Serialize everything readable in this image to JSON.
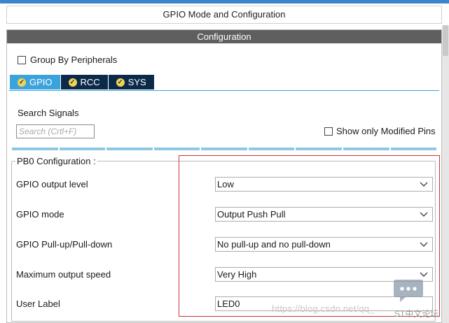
{
  "window": {
    "title": "GPIO Mode and Configuration"
  },
  "panel": {
    "header": "Configuration"
  },
  "group_by": {
    "label": "Group By Peripherals",
    "checked": false
  },
  "tabs": [
    {
      "label": "GPIO",
      "icon": "check-circle-icon",
      "active": true
    },
    {
      "label": "RCC",
      "icon": "check-circle-icon",
      "active": false
    },
    {
      "label": "SYS",
      "icon": "check-circle-icon",
      "active": false
    }
  ],
  "search": {
    "label": "Search Signals",
    "placeholder": "Search (Crtl+F)",
    "value": ""
  },
  "modified_pins": {
    "label": "Show only Modified Pins",
    "checked": false
  },
  "pb0": {
    "legend": "PB0 Configuration :",
    "rows": [
      {
        "label": "GPIO output level",
        "value": "Low",
        "type": "select"
      },
      {
        "label": "GPIO mode",
        "value": "Output Push Pull",
        "type": "select"
      },
      {
        "label": "GPIO Pull-up/Pull-down",
        "value": "No pull-up and no pull-down",
        "type": "select"
      },
      {
        "label": "Maximum output speed",
        "value": "Very High",
        "type": "select"
      },
      {
        "label": "User Label",
        "value": "LED0",
        "type": "text"
      }
    ]
  },
  "watermark": {
    "text": "https://blog.csdn.net/qq_",
    "sub": "ST中文论坛"
  },
  "colors": {
    "tab_active": "#3ba3dc",
    "tab_inactive": "#0b2a4a",
    "header_bg": "#5f5f5f",
    "highlight": "#c8323a",
    "icon_fill": "#f0d255"
  }
}
